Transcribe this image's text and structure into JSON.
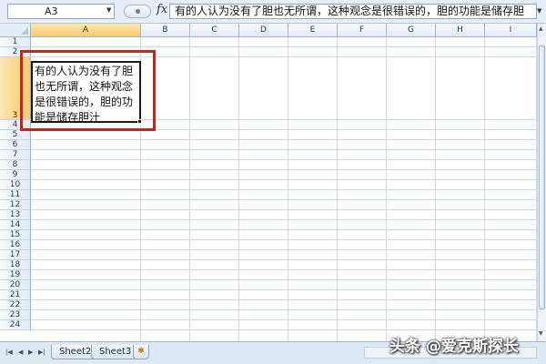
{
  "formula_bar": {
    "name_box": "A3",
    "fx_label": "fx",
    "content": "有的人认为没有了胆也无所谓，这种观念是很错误的，胆的功能是储存胆"
  },
  "columns": [
    "A",
    "B",
    "C",
    "D",
    "E",
    "F",
    "G",
    "H",
    "I"
  ],
  "rows": [
    "1",
    "2",
    "3",
    "4",
    "5",
    "6",
    "7",
    "8",
    "9",
    "10",
    "11",
    "12",
    "13",
    "14",
    "15",
    "16",
    "17",
    "18",
    "19",
    "20",
    "21",
    "22",
    "23",
    "24"
  ],
  "selected_cell": {
    "text": "有的人认为没有了胆也无所谓，这种观念是很错误的，胆的功能是储存胆汁"
  },
  "sheet_tabs": [
    "Sheet2",
    "Sheet3"
  ],
  "watermark": "头条 @爱克斯探长",
  "colors": {
    "highlight": "#c0271f",
    "header_active": "#f7c96c"
  }
}
